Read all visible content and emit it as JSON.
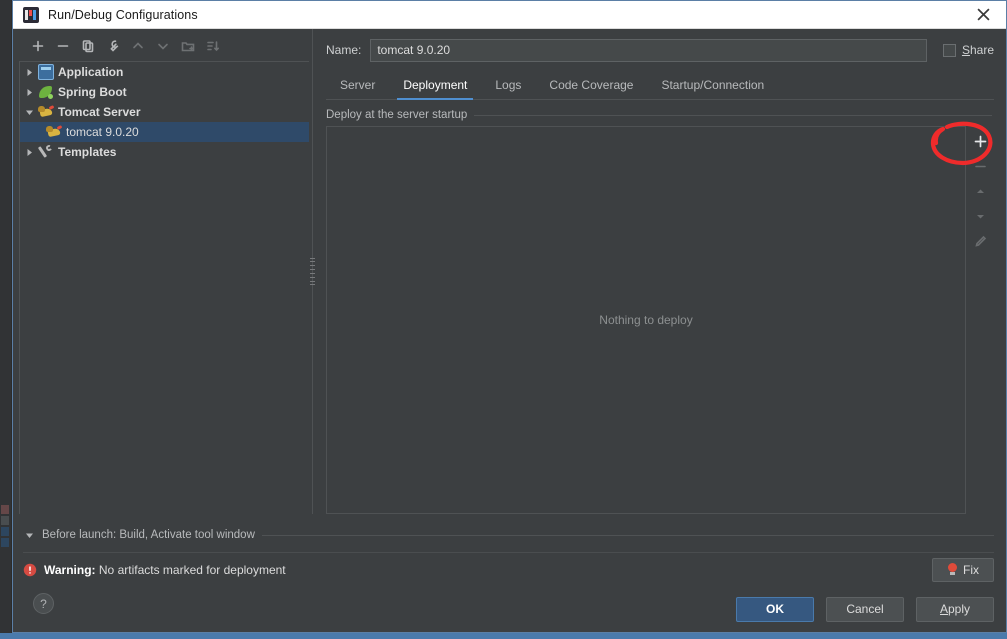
{
  "window": {
    "title": "Run/Debug Configurations",
    "app_icon": "intellij-idea-icon",
    "close_icon": "close-icon"
  },
  "left_pane": {
    "toolbar": [
      {
        "name": "add-configuration-button",
        "icon": "plus-icon",
        "enabled": true
      },
      {
        "name": "remove-configuration-button",
        "icon": "minus-icon",
        "enabled": true
      },
      {
        "name": "copy-configuration-button",
        "icon": "copy-icon",
        "enabled": true
      },
      {
        "name": "edit-templates-button",
        "icon": "wrench-icon",
        "enabled": true
      },
      {
        "name": "move-up-button",
        "icon": "arrow-up-icon",
        "enabled": false
      },
      {
        "name": "move-down-button",
        "icon": "arrow-down-icon",
        "enabled": false
      },
      {
        "name": "move-into-folder-button",
        "icon": "folder-add-icon",
        "enabled": false
      },
      {
        "name": "sort-configurations-button",
        "icon": "sort-icon",
        "enabled": false
      }
    ],
    "tree": [
      {
        "label": "Application",
        "icon": "application-icon",
        "expanded": false,
        "group": true,
        "selected": false,
        "child": false
      },
      {
        "label": "Spring Boot",
        "icon": "spring-boot-icon",
        "expanded": false,
        "group": true,
        "selected": false,
        "child": false
      },
      {
        "label": "Tomcat Server",
        "icon": "tomcat-icon",
        "expanded": true,
        "group": true,
        "selected": false,
        "child": false
      },
      {
        "label": "tomcat 9.0.20",
        "icon": "tomcat-icon",
        "expanded": null,
        "group": false,
        "selected": true,
        "child": true
      },
      {
        "label": "Templates",
        "icon": "wrench-icon",
        "expanded": false,
        "group": true,
        "selected": false,
        "child": false
      }
    ]
  },
  "right_pane": {
    "name_label": "Name:",
    "name_value": "tomcat 9.0.20",
    "name_placeholder": "Name",
    "share_label": "Share",
    "share_checked": false,
    "tabs": [
      {
        "label": "Server",
        "active": false
      },
      {
        "label": "Deployment",
        "active": true
      },
      {
        "label": "Logs",
        "active": false
      },
      {
        "label": "Code Coverage",
        "active": false
      },
      {
        "label": "Startup/Connection",
        "active": false
      }
    ],
    "deployment": {
      "group_title": "Deploy at the server startup",
      "empty_text": "Nothing to deploy",
      "side_toolbar": [
        {
          "name": "add-artifact-button",
          "icon": "plus-icon",
          "enabled": true
        },
        {
          "name": "remove-artifact-button",
          "icon": "minus-icon",
          "enabled": false
        },
        {
          "name": "move-up-button",
          "icon": "arrow-up-icon",
          "enabled": false
        },
        {
          "name": "move-down-button",
          "icon": "arrow-down-icon",
          "enabled": false
        },
        {
          "name": "edit-artifact-button",
          "icon": "pencil-icon",
          "enabled": false
        }
      ]
    }
  },
  "before_launch": {
    "text": "Before launch: Build, Activate tool window",
    "expanded": false,
    "toggle_icon": "triangle-down-icon"
  },
  "footer": {
    "warning_icon": "error-circle-icon",
    "warning_label": "Warning:",
    "warning_message": "No artifacts marked for deployment",
    "fix_label": "Fix",
    "fix_icon": "lightbulb-icon",
    "ok_label": "OK",
    "cancel_label": "Cancel",
    "apply_label_pre": "A",
    "apply_label_post": "pply",
    "help_label": "?"
  },
  "annotation": {
    "type": "hand-drawn-circle",
    "color": "#ef2b2b",
    "target": "add-artifact-button"
  },
  "colors": {
    "dialog_bg": "#3c3f41",
    "titlebar_bg": "#ffffff",
    "selection_blue": "#2f4a69",
    "accent_blue": "#4f8fd0",
    "primary_button": "#365880",
    "warning_red": "#e04b3a",
    "annotation_red": "#ef2b2b",
    "text": "#dcdcdc"
  }
}
